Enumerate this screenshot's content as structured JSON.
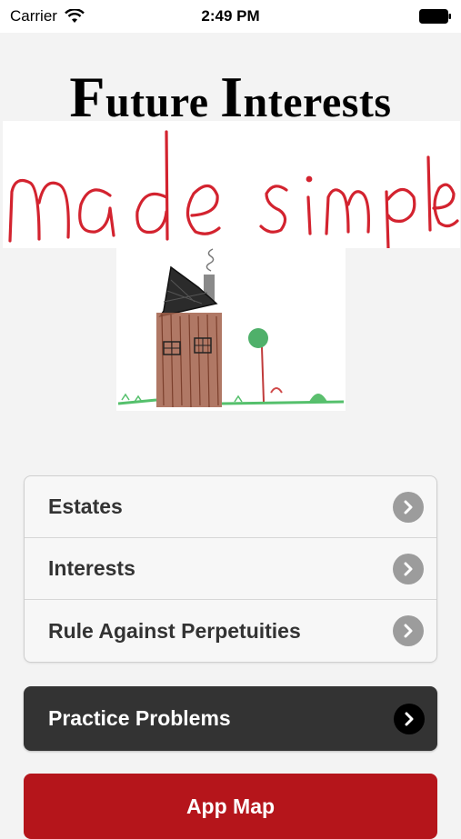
{
  "status_bar": {
    "carrier": "Carrier",
    "time": "2:49 PM",
    "wifi_icon": "wifi-icon",
    "battery_icon": "battery-icon"
  },
  "header": {
    "title_first_cap": "F",
    "title_first_rest": "uture",
    "title_second_cap": "I",
    "title_second_rest": "nterests",
    "handwritten_subtitle": "made simple",
    "illustration": "house-drawing"
  },
  "menu": {
    "items": [
      {
        "label": "Estates",
        "icon": "chevron-right-icon"
      },
      {
        "label": "Interests",
        "icon": "chevron-right-icon"
      },
      {
        "label": "Rule Against Perpetuities",
        "icon": "chevron-right-icon"
      }
    ]
  },
  "practice_button": {
    "label": "Practice Problems",
    "icon": "chevron-right-icon"
  },
  "app_map_button": {
    "label": "App Map"
  },
  "colors": {
    "background": "#f3f3f3",
    "dark_button": "#333333",
    "accent_red": "#b5151b",
    "chevron_gray": "#9c9c9c",
    "handwriting_red": "#d3232f"
  }
}
